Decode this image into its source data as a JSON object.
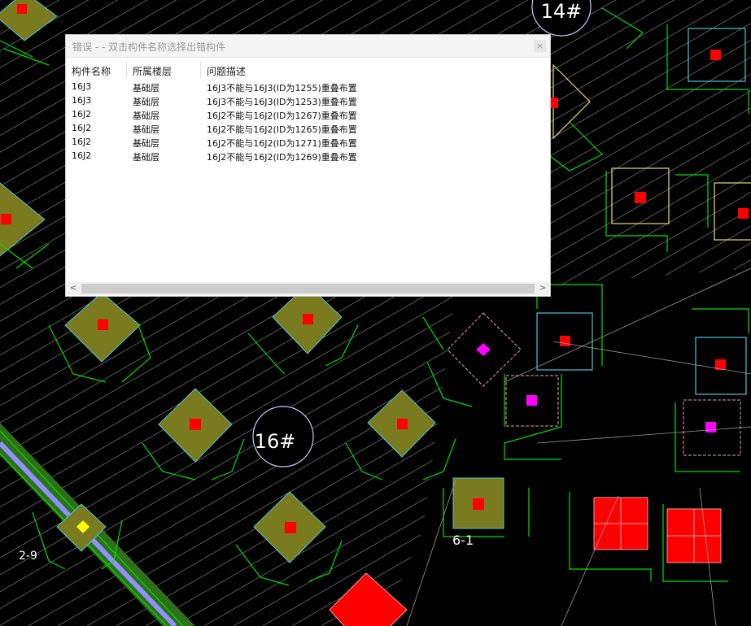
{
  "cad_labels": {
    "axis_14": "14#",
    "axis_16": "16#",
    "axis_6_1": "6-1",
    "axis_2_9": "2-9"
  },
  "colors": {
    "background": "#000000",
    "hatch": "#c8c8c8",
    "dim_green": "#00e000",
    "footing_olive": "#7a7a1e",
    "footing_red": "#ff0000",
    "cyan_outline": "#4ec6d8",
    "yellow_outline": "#e8e070",
    "pink_outline": "#e8a0a0",
    "magenta_marker": "#ff00ff",
    "beam_purple": "#9090ff"
  },
  "dialog": {
    "title": "错误 - - 双击构件名称选择出错构件",
    "close_icon": "×",
    "columns": [
      "构件名称",
      "所属楼层",
      "问题描述"
    ],
    "rows": [
      [
        "16J3",
        "基础层",
        "16J3不能与16J3(ID为1255)重叠布置"
      ],
      [
        "16J3",
        "基础层",
        "16J3不能与16J3(ID为1253)重叠布置"
      ],
      [
        "16J2",
        "基础层",
        "16J2不能与16J2(ID为1267)重叠布置"
      ],
      [
        "16J2",
        "基础层",
        "16J2不能与16J2(ID为1265)重叠布置"
      ],
      [
        "16J2",
        "基础层",
        "16J2不能与16J2(ID为1271)重叠布置"
      ],
      [
        "16J2",
        "基础层",
        "16J2不能与16J2(ID为1269)重叠布置"
      ]
    ],
    "scroll_left": "<",
    "scroll_right": ">"
  }
}
